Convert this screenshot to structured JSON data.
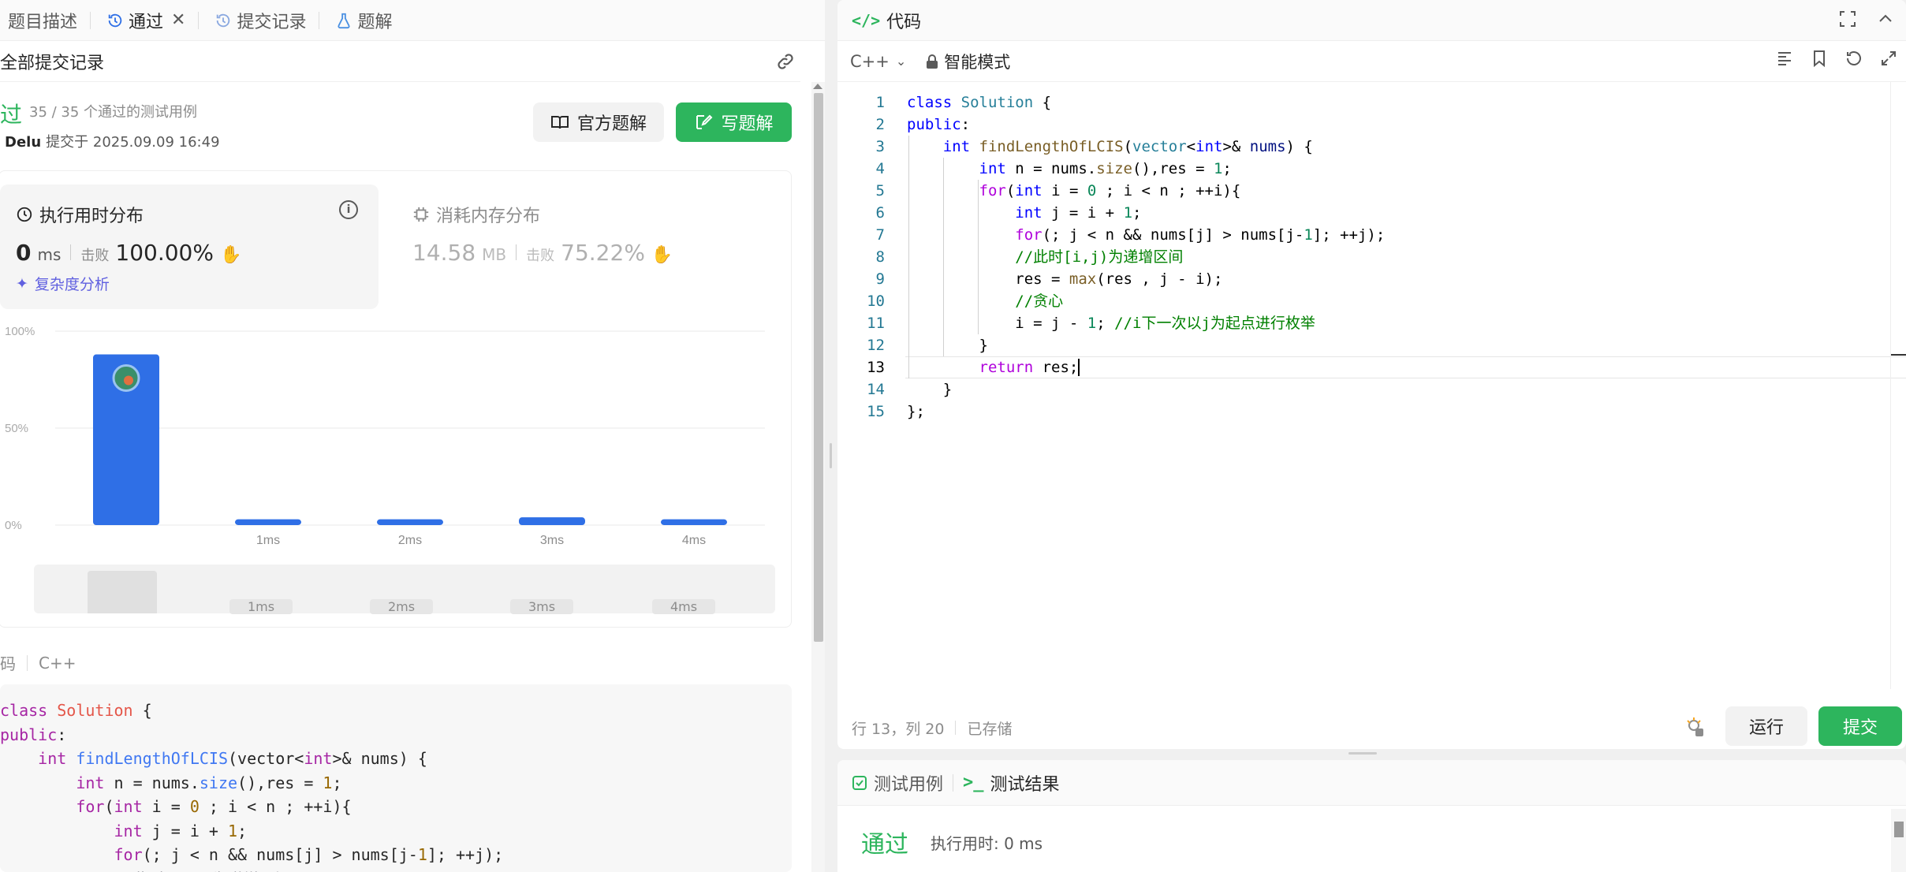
{
  "left_tabs": [
    {
      "label": "题目描述"
    },
    {
      "label": "通过",
      "closable": true
    },
    {
      "label": "提交记录"
    },
    {
      "label": "题解"
    }
  ],
  "sub_header": {
    "title": "全部提交记录"
  },
  "result": {
    "status": "过",
    "count": "35 / 35 个通过的测试用例",
    "user": "Delu",
    "submitted_at": "提交于 2025.09.09 16:49"
  },
  "buttons": {
    "official_solution": "官方题解",
    "write_solution": "写题解"
  },
  "runtime": {
    "title": "执行用时分布",
    "value": "0",
    "unit": "ms",
    "beat_label": "击败",
    "beat_value": "100.00%",
    "complexity": "复杂度分析"
  },
  "memory": {
    "title": "消耗内存分布",
    "value": "14.58",
    "unit": "MB",
    "beat_label": "击败",
    "beat_value": "75.22%"
  },
  "chart_data": {
    "type": "bar",
    "categories": [
      "0ms",
      "1ms",
      "2ms",
      "3ms",
      "4ms"
    ],
    "tick_labels": [
      "",
      "1ms",
      "2ms",
      "3ms",
      "4ms"
    ],
    "values": [
      88,
      3,
      3,
      4,
      3
    ],
    "ylabels": [
      "100%",
      "50%",
      "0%"
    ],
    "ylim": [
      0,
      100
    ],
    "bar_color": "#2f6fe6",
    "highlight_index": 0
  },
  "mini_chart": {
    "labels": [
      "1ms",
      "2ms",
      "3ms",
      "4ms"
    ]
  },
  "code_section": {
    "label": "码",
    "lang": "C++"
  },
  "editor": {
    "title": "代码",
    "language": "C++",
    "mode": "智能模式",
    "line_numbers": [
      "1",
      "2",
      "3",
      "4",
      "5",
      "6",
      "7",
      "8",
      "9",
      "10",
      "11",
      "12",
      "13",
      "14",
      "15"
    ],
    "status_position": "行 13，列 20",
    "status_saved": "已存储",
    "run_label": "运行",
    "submit_label": "提交"
  },
  "bottom_panel": {
    "tab_testcase": "测试用例",
    "tab_result": "测试结果",
    "result_status": "通过",
    "runtime": "执行用时: 0 ms"
  },
  "colors": {
    "accent_green": "#2db55d",
    "bar_blue": "#2f6fe6"
  }
}
